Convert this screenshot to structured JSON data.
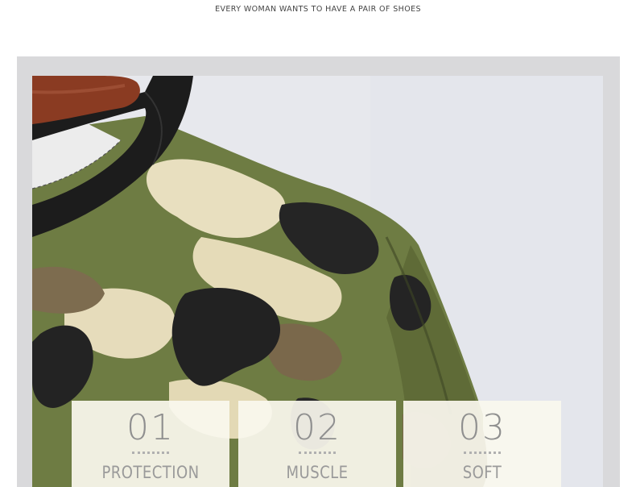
{
  "header": {
    "tagline": "EVERY WOMAN WANTS TO HAVE A PAIR OF SHOES"
  },
  "photo": {
    "subject": "camouflage-jacket-shoulder",
    "colors": {
      "background": "#e6e7ec",
      "camo_green": "#6f7d44",
      "camo_beige": "#e9dfbf",
      "camo_brown": "#7a6a4e",
      "camo_black": "#222222",
      "hanger": "#8a3b22"
    }
  },
  "features": [
    {
      "number": "01",
      "label": "PROTECTION"
    },
    {
      "number": "02",
      "label": "MUSCLE"
    },
    {
      "number": "03",
      "label": "SOFT"
    }
  ]
}
